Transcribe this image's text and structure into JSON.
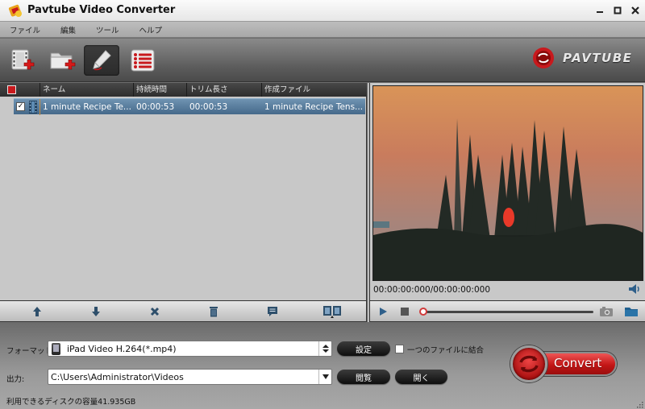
{
  "window": {
    "title": "Pavtube Video Converter",
    "controls": {
      "minimize": "—",
      "maximize": "□",
      "close": "✕"
    }
  },
  "menu": {
    "items": [
      {
        "label": "ファイル"
      },
      {
        "label": "編集"
      },
      {
        "label": "ツール"
      },
      {
        "label": "ヘルプ"
      }
    ]
  },
  "toolbar": {
    "buttons": [
      {
        "name": "add-video",
        "icon": "film-add-icon"
      },
      {
        "name": "add-folder",
        "icon": "folder-add-icon"
      },
      {
        "name": "edit",
        "icon": "pencil-icon",
        "active": true
      },
      {
        "name": "task-list",
        "icon": "list-icon"
      }
    ],
    "brand_text": "PAVTUBE"
  },
  "file_list": {
    "header_checked": true,
    "columns": [
      "ネーム",
      "持続時間",
      "トリム長さ",
      "作成ファイル"
    ],
    "rows": [
      {
        "checked": true,
        "check_glyph": "✓",
        "name": "1 minute Recipe  Te...",
        "duration": "00:00:53",
        "trim_length": "00:00:53",
        "output_file": "1 minute Recipe  Tens..."
      }
    ]
  },
  "list_actions": [
    {
      "name": "move-up",
      "icon": "arrow-up-icon"
    },
    {
      "name": "move-down",
      "icon": "arrow-down-icon"
    },
    {
      "name": "remove",
      "icon": "x-icon"
    },
    {
      "name": "clear",
      "icon": "trash-icon"
    },
    {
      "name": "subtitle",
      "icon": "speech-bubble-icon"
    },
    {
      "name": "merge",
      "icon": "film-merge-icon"
    }
  ],
  "preview": {
    "time_readout": "00:00:00:000/00:00:00:000",
    "seek_progress": 0
  },
  "settings": {
    "format_label": "フォーマット:",
    "format_value": "iPad Video H.264(*.mp4)",
    "settings_button": "設定",
    "merge_label": "一つのファイルに結合",
    "merge_checked": false,
    "output_label": "出力:",
    "output_value": "C:\\Users\\Administrator\\Videos",
    "browse_button": "閲覧",
    "open_button": "開く",
    "disk_space": "利用できるディスクの容量41.935GB",
    "convert_button": "Convert"
  },
  "colors": {
    "accent_red": "#c8191d",
    "row_selected": "#5a7fa0",
    "pane_bg": "#c8c8c8"
  }
}
